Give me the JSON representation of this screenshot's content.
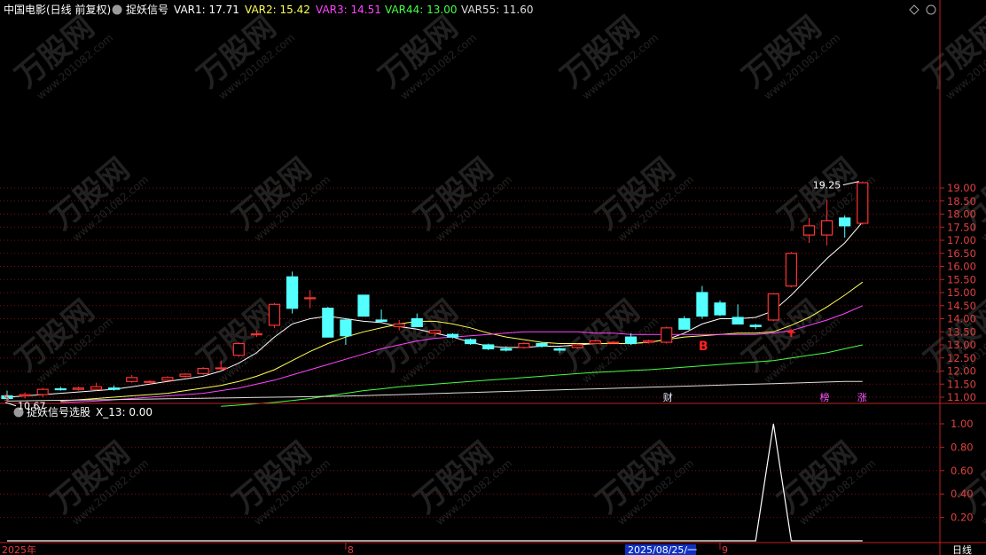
{
  "header": {
    "stock": "中国电影(日线 前复权)",
    "indicator": "捉妖信号",
    "indicators": [
      {
        "label": "VAR1: 17.71",
        "color": "#ffffff"
      },
      {
        "label": "VAR2: 15.42",
        "color": "#ffff55"
      },
      {
        "label": "VAR3: 14.51",
        "color": "#ff44ff"
      },
      {
        "label": "VAR44: 13.00",
        "color": "#44ff44"
      },
      {
        "label": "VAR55: 11.60",
        "color": "#dddddd"
      }
    ]
  },
  "sub_header": {
    "title": "捉妖信号选股",
    "value": "X_13: 0.00"
  },
  "labels": {
    "max_price": "19.25",
    "min_price": "10.67",
    "signal": "B",
    "date_cursor": "2025/08/25/一",
    "period": "日线",
    "markers": [
      "$",
      "财",
      "榜",
      "涨"
    ]
  },
  "x_axis_labels": [
    "2025年",
    "8",
    "9"
  ],
  "watermark": {
    "name": "万股网",
    "url": "www.201082.com"
  },
  "chart_data": {
    "type": "candlestick",
    "price_axis": {
      "min": 10.7,
      "max": 19.2,
      "ticks": [
        11.0,
        11.5,
        12.0,
        12.5,
        13.0,
        13.5,
        14.0,
        14.5,
        15.0,
        15.5,
        16.0,
        16.5,
        17.0,
        17.5,
        18.0,
        18.5,
        19.0
      ]
    },
    "candles": [
      {
        "o": 11.05,
        "h": 11.25,
        "l": 10.85,
        "c": 10.95
      },
      {
        "o": 11.05,
        "h": 11.18,
        "l": 10.95,
        "c": 11.1
      },
      {
        "o": 11.1,
        "h": 11.35,
        "l": 11.0,
        "c": 11.3
      },
      {
        "o": 11.32,
        "h": 11.4,
        "l": 11.25,
        "c": 11.3
      },
      {
        "o": 11.3,
        "h": 11.4,
        "l": 11.25,
        "c": 11.35
      },
      {
        "o": 11.3,
        "h": 11.55,
        "l": 11.25,
        "c": 11.4
      },
      {
        "o": 11.35,
        "h": 11.45,
        "l": 11.25,
        "c": 11.3
      },
      {
        "o": 11.6,
        "h": 11.85,
        "l": 11.55,
        "c": 11.75
      },
      {
        "o": 11.6,
        "h": 11.65,
        "l": 11.55,
        "c": 11.6
      },
      {
        "o": 11.65,
        "h": 11.8,
        "l": 11.62,
        "c": 11.75
      },
      {
        "o": 11.8,
        "h": 11.92,
        "l": 11.75,
        "c": 11.88
      },
      {
        "o": 11.9,
        "h": 12.15,
        "l": 11.85,
        "c": 12.1
      },
      {
        "o": 12.1,
        "h": 12.4,
        "l": 12.05,
        "c": 12.12
      },
      {
        "o": 12.6,
        "h": 13.1,
        "l": 12.55,
        "c": 13.05
      },
      {
        "o": 13.4,
        "h": 13.55,
        "l": 13.3,
        "c": 13.42
      },
      {
        "o": 13.75,
        "h": 14.6,
        "l": 13.65,
        "c": 14.55
      },
      {
        "o": 15.6,
        "h": 15.8,
        "l": 14.2,
        "c": 14.4
      },
      {
        "o": 14.8,
        "h": 15.1,
        "l": 14.4,
        "c": 14.8
      },
      {
        "o": 14.4,
        "h": 14.45,
        "l": 13.3,
        "c": 13.3
      },
      {
        "o": 13.95,
        "h": 14.0,
        "l": 13.0,
        "c": 13.35
      },
      {
        "o": 14.9,
        "h": 14.9,
        "l": 14.1,
        "c": 14.1
      },
      {
        "o": 13.95,
        "h": 14.35,
        "l": 13.85,
        "c": 13.9
      },
      {
        "o": 13.7,
        "h": 13.95,
        "l": 13.55,
        "c": 13.8
      },
      {
        "o": 14.0,
        "h": 14.2,
        "l": 13.8,
        "c": 13.7
      },
      {
        "o": 13.45,
        "h": 13.6,
        "l": 13.35,
        "c": 13.55
      },
      {
        "o": 13.4,
        "h": 13.45,
        "l": 13.25,
        "c": 13.3
      },
      {
        "o": 13.2,
        "h": 13.25,
        "l": 13.0,
        "c": 13.05
      },
      {
        "o": 13.0,
        "h": 13.05,
        "l": 12.8,
        "c": 12.85
      },
      {
        "o": 12.85,
        "h": 12.95,
        "l": 12.75,
        "c": 12.8
      },
      {
        "o": 12.9,
        "h": 13.1,
        "l": 12.85,
        "c": 13.05
      },
      {
        "o": 13.05,
        "h": 13.1,
        "l": 12.9,
        "c": 12.95
      },
      {
        "o": 12.85,
        "h": 12.9,
        "l": 12.7,
        "c": 12.8
      },
      {
        "o": 12.9,
        "h": 13.05,
        "l": 12.85,
        "c": 13.0
      },
      {
        "o": 13.05,
        "h": 13.2,
        "l": 13.02,
        "c": 13.15
      },
      {
        "o": 13.1,
        "h": 13.15,
        "l": 13.05,
        "c": 13.1
      },
      {
        "o": 13.3,
        "h": 13.45,
        "l": 13.0,
        "c": 13.05
      },
      {
        "o": 13.1,
        "h": 13.2,
        "l": 13.05,
        "c": 13.15
      },
      {
        "o": 13.1,
        "h": 13.7,
        "l": 13.05,
        "c": 13.65
      },
      {
        "o": 14.0,
        "h": 14.1,
        "l": 13.6,
        "c": 13.6
      },
      {
        "o": 15.0,
        "h": 15.25,
        "l": 14.0,
        "c": 14.1
      },
      {
        "o": 14.6,
        "h": 14.7,
        "l": 14.1,
        "c": 14.15
      },
      {
        "o": 14.05,
        "h": 14.55,
        "l": 13.8,
        "c": 13.8
      },
      {
        "o": 13.75,
        "h": 13.8,
        "l": 13.6,
        "c": 13.7
      },
      {
        "o": 13.95,
        "h": 14.2,
        "l": 13.9,
        "c": 14.95
      },
      {
        "o": 15.25,
        "h": 16.55,
        "l": 15.2,
        "c": 16.5
      },
      {
        "o": 17.2,
        "h": 17.85,
        "l": 16.9,
        "c": 17.55
      },
      {
        "o": 17.2,
        "h": 18.55,
        "l": 16.8,
        "c": 17.75
      },
      {
        "o": 17.85,
        "h": 17.95,
        "l": 17.1,
        "c": 17.55
      },
      {
        "o": 17.65,
        "h": 19.25,
        "l": 17.6,
        "c": 19.2
      }
    ],
    "series": [
      {
        "name": "VAR1",
        "color": "#ffffff",
        "values": [
          11.0,
          11.05,
          11.1,
          11.15,
          11.2,
          11.25,
          11.3,
          11.4,
          11.5,
          11.6,
          11.7,
          11.8,
          12.0,
          12.3,
          12.7,
          13.3,
          13.8,
          14.0,
          14.1,
          14.0,
          13.9,
          13.85,
          13.7,
          13.6,
          13.45,
          13.3,
          13.1,
          12.95,
          12.9,
          12.9,
          12.95,
          12.95,
          13.0,
          13.05,
          13.05,
          13.05,
          13.1,
          13.2,
          13.45,
          13.8,
          14.0,
          14.0,
          14.05,
          14.3,
          14.9,
          15.6,
          16.3,
          16.9,
          17.7
        ]
      },
      {
        "name": "VAR2",
        "color": "#ffff55",
        "values": [
          null,
          null,
          null,
          10.85,
          10.9,
          10.95,
          11.0,
          11.05,
          11.1,
          11.15,
          11.25,
          11.35,
          11.45,
          11.6,
          11.8,
          12.05,
          12.4,
          12.75,
          13.05,
          13.3,
          13.5,
          13.65,
          13.8,
          13.9,
          13.9,
          13.8,
          13.65,
          13.45,
          13.3,
          13.2,
          13.1,
          13.05,
          13.05,
          13.05,
          13.05,
          13.05,
          13.1,
          13.2,
          13.3,
          13.35,
          13.4,
          13.45,
          13.45,
          13.5,
          13.75,
          14.05,
          14.45,
          14.9,
          15.4
        ]
      },
      {
        "name": "VAR3",
        "color": "#ff44ff",
        "values": [
          null,
          null,
          null,
          10.8,
          10.82,
          10.85,
          10.9,
          10.95,
          11.0,
          11.05,
          11.1,
          11.15,
          11.25,
          11.35,
          11.5,
          11.65,
          11.85,
          12.05,
          12.25,
          12.45,
          12.65,
          12.85,
          13.0,
          13.15,
          13.25,
          13.3,
          13.35,
          13.4,
          13.45,
          13.5,
          13.5,
          13.5,
          13.5,
          13.45,
          13.45,
          13.4,
          13.4,
          13.4,
          13.4,
          13.4,
          13.4,
          13.4,
          13.4,
          13.45,
          13.55,
          13.75,
          13.95,
          14.2,
          14.5
        ]
      },
      {
        "name": "VAR44",
        "color": "#44ff44",
        "values": [
          null,
          null,
          null,
          null,
          null,
          null,
          null,
          null,
          null,
          null,
          null,
          null,
          10.65,
          10.7,
          10.75,
          10.8,
          10.87,
          10.95,
          11.05,
          11.15,
          11.25,
          11.32,
          11.4,
          11.45,
          11.5,
          11.55,
          11.6,
          11.65,
          11.7,
          11.75,
          11.8,
          11.85,
          11.9,
          11.95,
          11.98,
          12.02,
          12.05,
          12.1,
          12.15,
          12.2,
          12.25,
          12.3,
          12.35,
          12.4,
          12.5,
          12.6,
          12.7,
          12.85,
          13.0
        ]
      },
      {
        "name": "VAR55",
        "color": "#dddddd",
        "values": [
          10.85,
          10.86,
          10.87,
          10.88,
          10.89,
          10.9,
          10.91,
          10.92,
          10.93,
          10.94,
          10.95,
          10.96,
          10.97,
          10.98,
          10.99,
          11.0,
          11.01,
          11.02,
          11.03,
          11.04,
          11.06,
          11.08,
          11.1,
          11.12,
          11.14,
          11.16,
          11.18,
          11.2,
          11.22,
          11.24,
          11.26,
          11.28,
          11.3,
          11.32,
          11.34,
          11.36,
          11.38,
          11.4,
          11.42,
          11.44,
          11.46,
          11.48,
          11.5,
          11.52,
          11.54,
          11.56,
          11.58,
          11.6,
          11.6
        ]
      }
    ],
    "sub_chart": {
      "name": "X_13",
      "ticks": [
        0.2,
        0.4,
        0.6,
        0.8,
        1.0
      ],
      "ylim": [
        0,
        1.0
      ],
      "values": [
        0,
        0,
        0,
        0,
        0,
        0,
        0,
        0,
        0,
        0,
        0,
        0,
        0,
        0,
        0,
        0,
        0,
        0,
        0,
        0,
        0,
        0,
        0,
        0,
        0,
        0,
        0,
        0,
        0,
        0,
        0,
        0,
        0,
        0,
        0,
        0,
        0,
        0,
        0,
        0,
        0,
        0,
        0,
        1,
        0,
        0,
        0,
        0,
        0
      ]
    }
  }
}
